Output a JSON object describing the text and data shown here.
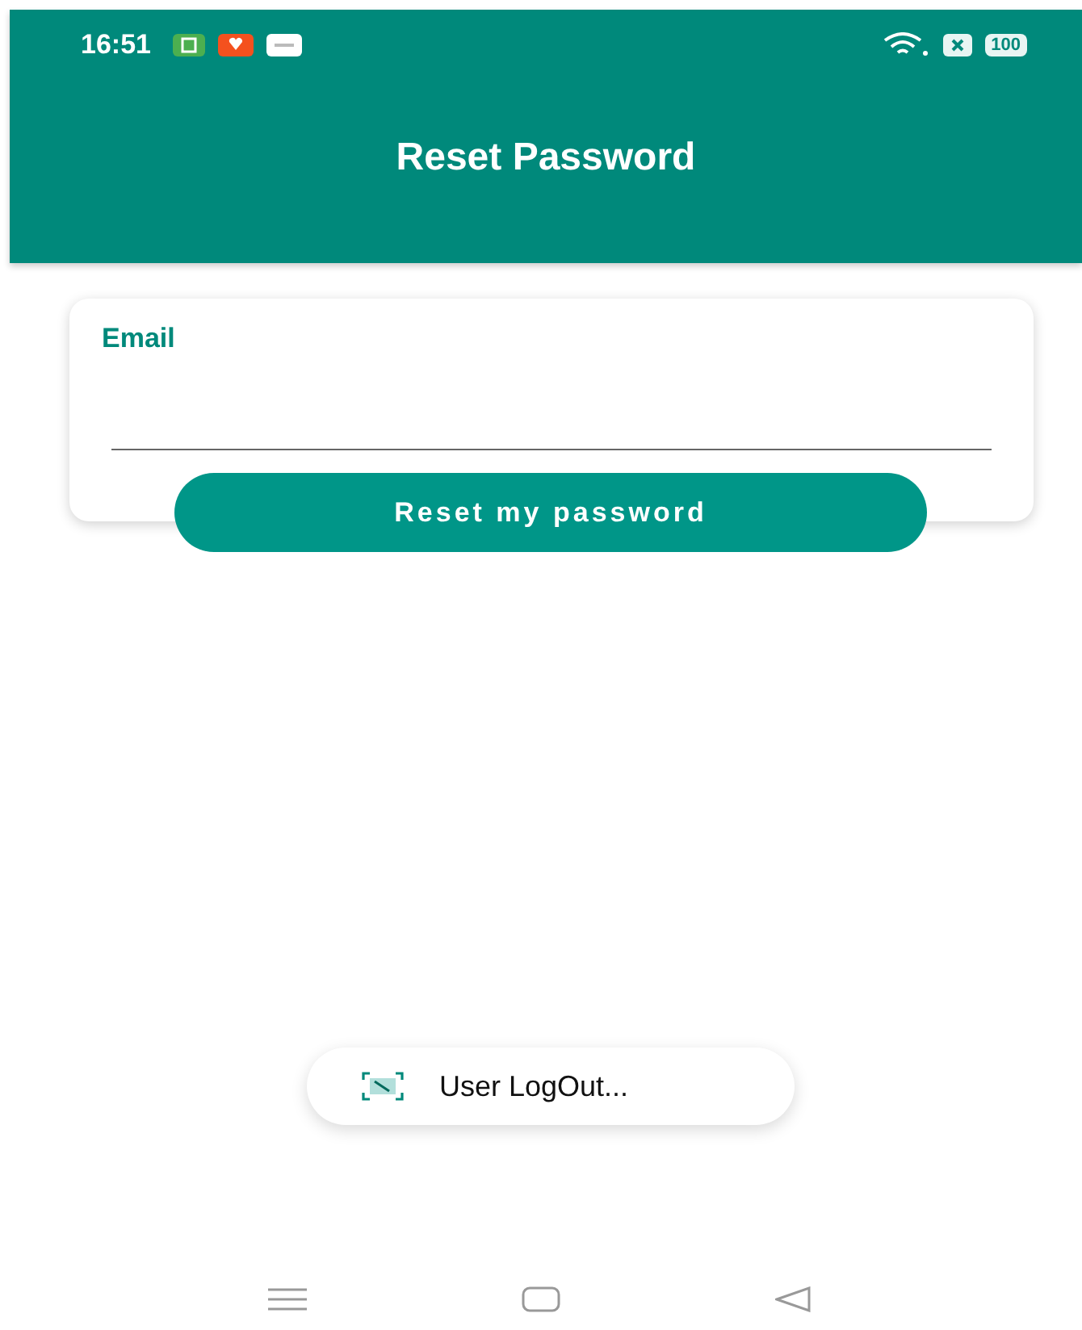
{
  "status_bar": {
    "time": "16:51",
    "battery": "100"
  },
  "app_bar": {
    "title": "Reset Password"
  },
  "form": {
    "field_label": "Email",
    "button": "Reset my password"
  },
  "toast": {
    "text": "User LogOut..."
  }
}
